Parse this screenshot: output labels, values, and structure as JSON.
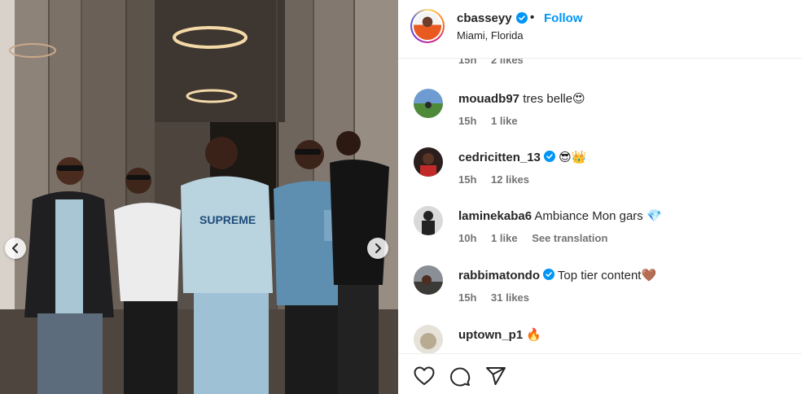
{
  "post": {
    "username": "cbasseyy",
    "verified": true,
    "separator": "•",
    "follow_label": "Follow",
    "location": "Miami, Florida"
  },
  "partial_comment": {
    "time": "15h",
    "likes": "2 likes"
  },
  "comments": [
    {
      "username": "mouadb97",
      "verified": false,
      "text": "tres belle😍",
      "time": "15h",
      "likes": "1 like",
      "extra": ""
    },
    {
      "username": "cedricitten_13",
      "verified": true,
      "text": "😎👑",
      "time": "15h",
      "likes": "12 likes",
      "extra": ""
    },
    {
      "username": "laminekaba6",
      "verified": false,
      "text": "Ambiance Mon gars 💎",
      "time": "10h",
      "likes": "1 like",
      "extra": "See translation"
    },
    {
      "username": "rabbimatondo",
      "verified": true,
      "text": "Top tier content🤎",
      "time": "15h",
      "likes": "31 likes",
      "extra": ""
    },
    {
      "username": "uptown_p1",
      "verified": false,
      "text": "🔥",
      "time": "",
      "likes": "",
      "extra": ""
    }
  ],
  "icons": {
    "like": "heart-icon",
    "comment": "comment-icon",
    "share": "share-icon",
    "prev": "chevron-left-icon",
    "next": "chevron-right-icon",
    "verified": "verified-badge-icon"
  },
  "colors": {
    "accent": "#0095f6",
    "verified": "#0095f6",
    "text": "#262626",
    "muted": "#737373"
  }
}
